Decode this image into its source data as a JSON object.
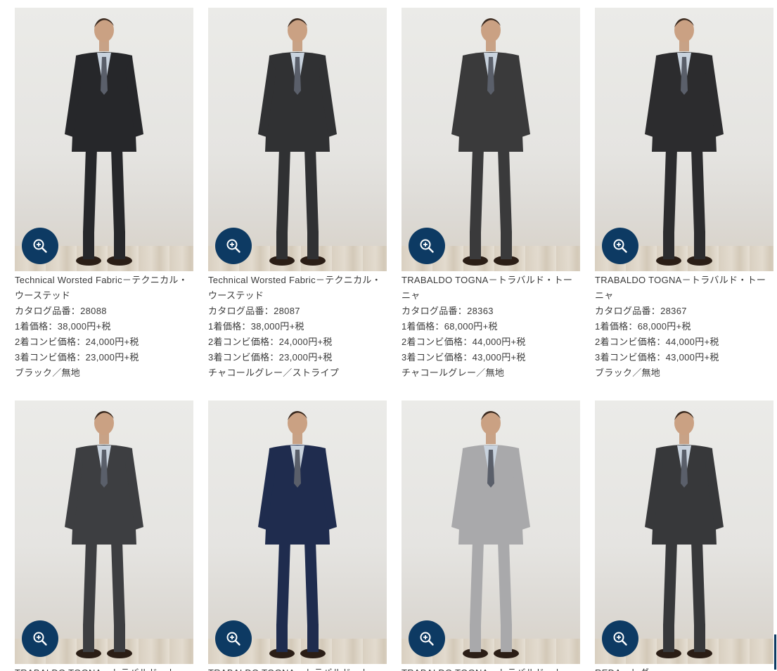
{
  "colors": {
    "zoom_button": "#0d3a63",
    "text": "#3a3a3a"
  },
  "products": [
    {
      "title": "Technical Worsted Fabric－テクニカル・ウーステッド",
      "catalog": "カタログ品番：28088",
      "price_1": "1着価格：38,000円+税",
      "price_2": "2着コンビ価格：24,000円+税",
      "price_3": "3着コンビ価格：23,000円+税",
      "color_pattern": "ブラック／無地",
      "zoom_icon": "zoom-in-icon",
      "suit_color": "#26272a"
    },
    {
      "title": "Technical Worsted Fabric－テクニカル・ウーステッド",
      "catalog": "カタログ品番：28087",
      "price_1": "1着価格：38,000円+税",
      "price_2": "2着コンビ価格：24,000円+税",
      "price_3": "3着コンビ価格：23,000円+税",
      "color_pattern": "チャコールグレー／ストライプ",
      "zoom_icon": "zoom-in-icon",
      "suit_color": "#303133"
    },
    {
      "title": "TRABALDO TOGNA－トラバルド・トーニャ",
      "catalog": "カタログ品番：28363",
      "price_1": "1着価格：68,000円+税",
      "price_2": "2着コンビ価格：44,000円+税",
      "price_3": "3着コンビ価格：43,000円+税",
      "color_pattern": "チャコールグレー／無地",
      "zoom_icon": "zoom-in-icon",
      "suit_color": "#3a3a3b"
    },
    {
      "title": "TRABALDO TOGNA－トラバルド・トーニャ",
      "catalog": "カタログ品番：28367",
      "price_1": "1着価格：68,000円+税",
      "price_2": "2着コンビ価格：44,000円+税",
      "price_3": "3着コンビ価格：43,000円+税",
      "color_pattern": "ブラック／無地",
      "zoom_icon": "zoom-in-icon",
      "suit_color": "#2c2c2e"
    },
    {
      "title": "TRABALDO TOGNA－トラバルド・トーニャ",
      "zoom_icon": "zoom-in-icon",
      "suit_color": "#3d3e41"
    },
    {
      "title": "TRABALDO TOGNA－トラバルド・トーニャ",
      "zoom_icon": "zoom-in-icon",
      "suit_color": "#1f2c4e"
    },
    {
      "title": "TRABALDO TOGNA－トラバルド・トーニャ",
      "zoom_icon": "zoom-in-icon",
      "suit_color": "#a9a9ab"
    },
    {
      "title": "REDA－レダ",
      "zoom_icon": "zoom-in-icon",
      "suit_color": "#37383a"
    }
  ]
}
